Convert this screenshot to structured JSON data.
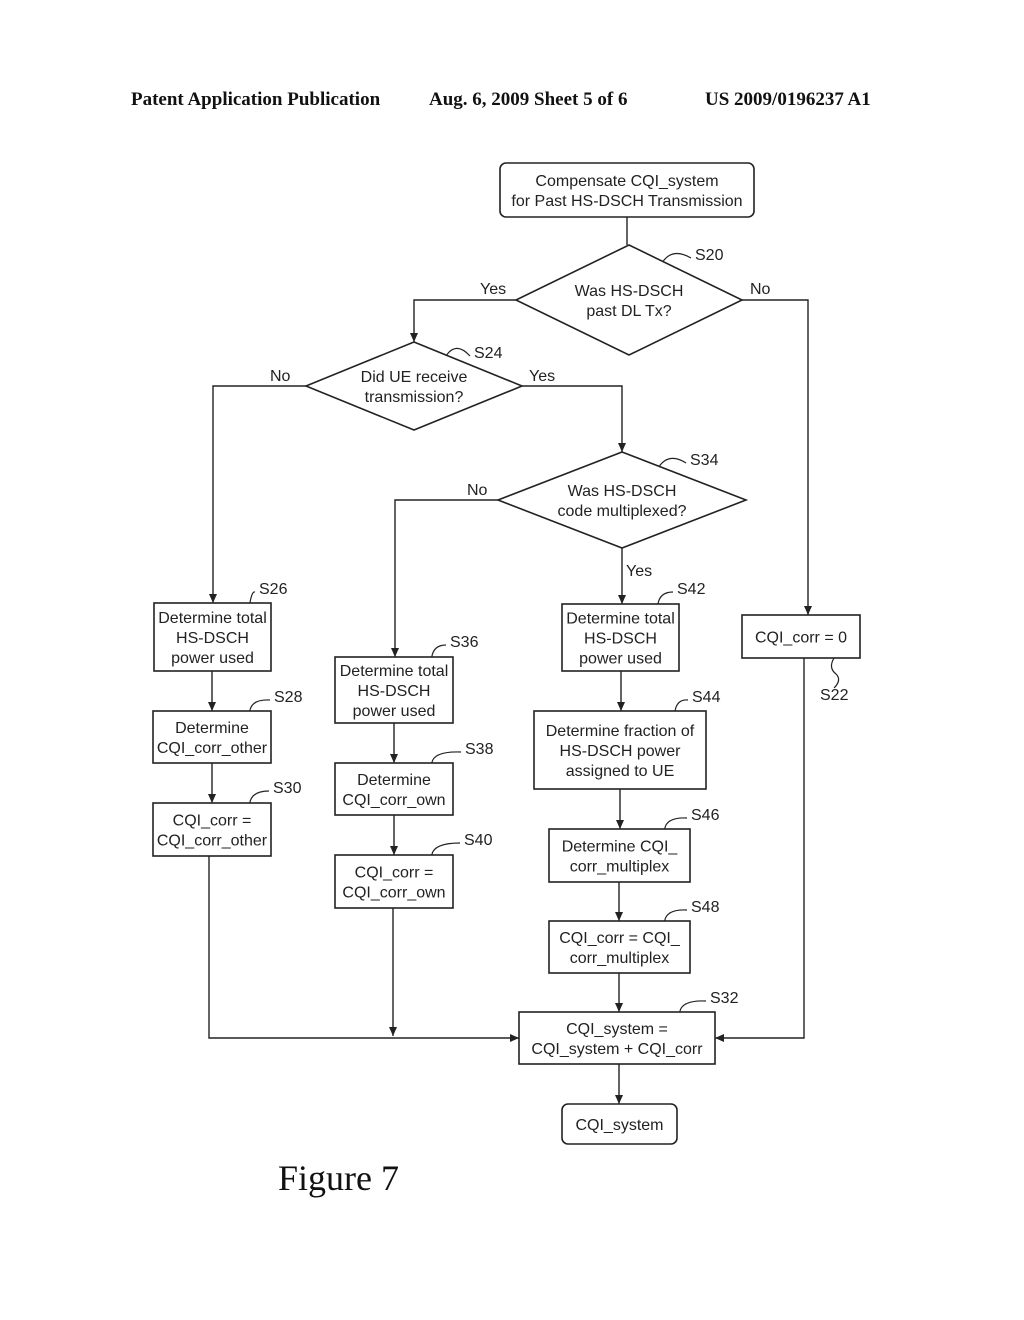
{
  "header": {
    "publication": "Patent Application Publication",
    "date_sheet": "Aug. 6, 2009   Sheet 5 of 6",
    "number": "US 2009/0196237 A1"
  },
  "figure_caption": "Figure 7",
  "nodes": {
    "start": {
      "lines": [
        "Compensate CQI_system",
        "for Past HS-DSCH Transmission"
      ]
    },
    "s20": {
      "ref": "S20",
      "lines": [
        "Was HS-DSCH",
        "past DL Tx?"
      ]
    },
    "s24": {
      "ref": "S24",
      "lines": [
        "Did UE receive",
        "transmission?"
      ]
    },
    "s34": {
      "ref": "S34",
      "lines": [
        "Was HS-DSCH",
        "code multiplexed?"
      ]
    },
    "s26": {
      "ref": "S26",
      "lines": [
        "Determine total",
        "HS-DSCH",
        "power used"
      ]
    },
    "s28": {
      "ref": "S28",
      "lines": [
        "Determine",
        "CQI_corr_other"
      ]
    },
    "s30": {
      "ref": "S30",
      "lines": [
        "CQI_corr =",
        "CQI_corr_other"
      ]
    },
    "s36": {
      "ref": "S36",
      "lines": [
        "Determine total",
        "HS-DSCH",
        "power used"
      ]
    },
    "s38": {
      "ref": "S38",
      "lines": [
        "Determine",
        "CQI_corr_own"
      ]
    },
    "s40": {
      "ref": "S40",
      "lines": [
        "CQI_corr =",
        "CQI_corr_own"
      ]
    },
    "s42": {
      "ref": "S42",
      "lines": [
        "Determine total",
        "HS-DSCH",
        "power used"
      ]
    },
    "s44": {
      "ref": "S44",
      "lines": [
        "Determine fraction of",
        "HS-DSCH power",
        "assigned to UE"
      ]
    },
    "s46": {
      "ref": "S46",
      "lines": [
        "Determine CQI_",
        "corr_multiplex"
      ]
    },
    "s48": {
      "ref": "S48",
      "lines": [
        "CQI_corr = CQI_",
        "corr_multiplex"
      ]
    },
    "s22": {
      "ref": "S22",
      "lines": [
        "CQI_corr = 0"
      ]
    },
    "s32": {
      "ref": "S32",
      "lines": [
        "CQI_system =",
        "CQI_system + CQI_corr"
      ]
    },
    "end": {
      "lines": [
        "CQI_system"
      ]
    }
  },
  "branch_labels": {
    "s20_yes": "Yes",
    "s20_no": "No",
    "s24_no": "No",
    "s24_yes": "Yes",
    "s34_no": "No",
    "s34_yes": "Yes"
  }
}
